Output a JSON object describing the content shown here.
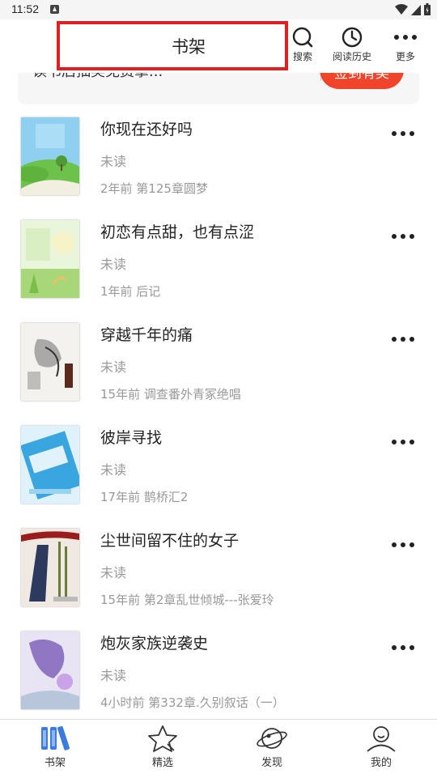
{
  "status_bar": {
    "time": "11:52"
  },
  "header": {
    "title": "书架",
    "actions": [
      {
        "icon": "search-icon",
        "label": "搜索"
      },
      {
        "icon": "clock-icon",
        "label": "阅读历史"
      },
      {
        "icon": "more-dots-icon",
        "label": "更多"
      }
    ]
  },
  "banner": {
    "text": "读书后抽奖免费拿...",
    "button_label": "签到有奖"
  },
  "books": [
    {
      "title": "你现在还好吗",
      "status": "未读",
      "latest": "2年前 第125章圆梦"
    },
    {
      "title": "初恋有点甜，也有点涩",
      "status": "未读",
      "latest": "1年前 后记"
    },
    {
      "title": "穿越千年的痛",
      "status": "未读",
      "latest": "15年前 调查番外青冢绝唱"
    },
    {
      "title": "彼岸寻找",
      "status": "未读",
      "latest": "17年前 鹊桥汇2"
    },
    {
      "title": "尘世间留不住的女子",
      "status": "未读",
      "latest": "15年前 第2章乱世倾城---张爱玲"
    },
    {
      "title": "炮灰家族逆袭史",
      "status": "未读",
      "latest": "4小时前 第332章.久别叙话（一）"
    }
  ],
  "tabs": [
    {
      "label": "书架",
      "icon": "bookshelf-icon",
      "active": true
    },
    {
      "label": "精选",
      "icon": "star-icon",
      "active": false
    },
    {
      "label": "发现",
      "icon": "planet-icon",
      "active": false
    },
    {
      "label": "我的",
      "icon": "user-icon",
      "active": false
    }
  ],
  "colors": {
    "accent": "#3a7be0",
    "highlight_border": "#e02020",
    "banner_button": "#f0452a"
  }
}
